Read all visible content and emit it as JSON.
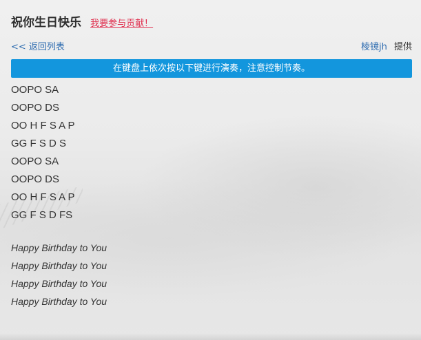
{
  "header": {
    "title": "祝你生日快乐",
    "contribute_link": "我要参与贡献！"
  },
  "nav": {
    "back_link": "<< 返回列表",
    "provider_name": "棱镜jh",
    "provider_suffix": "提供"
  },
  "banner": {
    "text": "在键盘上依次按以下键进行演奏，注意控制节奏。"
  },
  "notes": [
    "OOPO SA",
    "OOPO DS",
    "OO H F S A P",
    "GG F S D S",
    "OOPO SA",
    "OOPO DS",
    "OO H F S A P",
    "GG F S D FS"
  ],
  "lyrics": [
    "Happy Birthday to You",
    "Happy Birthday to You",
    "Happy Birthday to You",
    "Happy Birthday to You"
  ],
  "colors": {
    "banner_bg": "#1396dd",
    "link": "#2e6cb0",
    "contribute": "#e0304f"
  }
}
